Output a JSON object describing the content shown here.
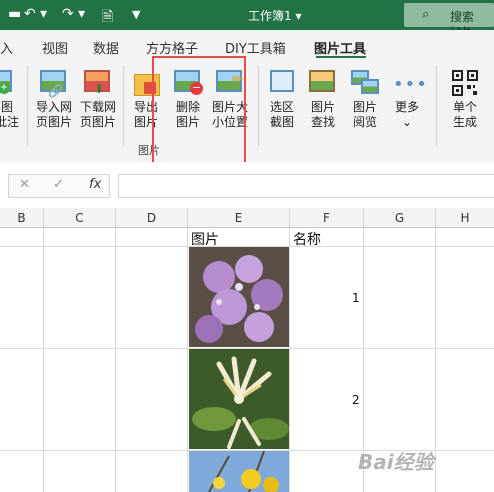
{
  "window": {
    "title": "工作簿1 ▾",
    "search_placeholder": "搜索(Alt"
  },
  "tabs": [
    "入",
    "视图",
    "数据",
    "方方格子",
    "DIY工具箱",
    "图片工具"
  ],
  "ribbon": {
    "buttons": [
      {
        "l1": "图",
        "l2": "批注"
      },
      {
        "l1": "导入网",
        "l2": "页图片"
      },
      {
        "l1": "下载网",
        "l2": "页图片"
      },
      {
        "l1": "导出",
        "l2": "图片"
      },
      {
        "l1": "删除",
        "l2": "图片"
      },
      {
        "l1": "图片大",
        "l2": "小位置"
      },
      {
        "l1": "选区",
        "l2": "截图"
      },
      {
        "l1": "图片",
        "l2": "查找"
      },
      {
        "l1": "图片",
        "l2": "阅览"
      },
      {
        "l1": "更多",
        "l2": "⌄"
      },
      {
        "l1": "单个",
        "l2": "生成"
      }
    ],
    "group_label": "图片"
  },
  "formula_bar": {
    "cancel": "✕",
    "enter": "✓",
    "fx": "fx",
    "value": ""
  },
  "columns": [
    "B",
    "C",
    "D",
    "E",
    "F",
    "G",
    "H"
  ],
  "cells": {
    "E_header": "图片",
    "F_header": "名称",
    "row1_name": "1",
    "row2_name": "2"
  },
  "watermark": "Bai经验"
}
